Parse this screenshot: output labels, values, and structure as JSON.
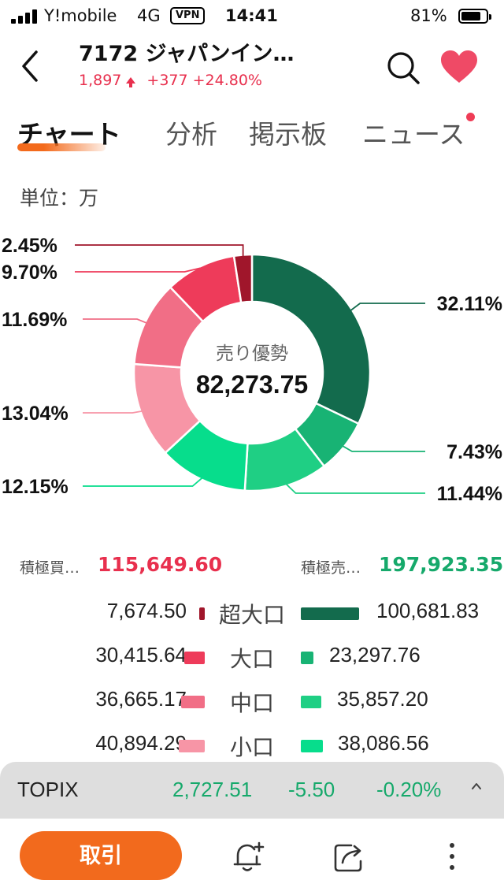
{
  "status_bar": {
    "carrier": "Y!mobile",
    "network": "4G",
    "vpn": "VPN",
    "time": "14:41",
    "battery": "81%"
  },
  "header": {
    "title": "7172 ジャパンイン…",
    "price": "1,897",
    "change": "+377",
    "change_pct": "+24.80%",
    "accent_color": "#e8304e"
  },
  "tabs": [
    {
      "label": "チャート",
      "active": true
    },
    {
      "label": "分析"
    },
    {
      "label": "掲示板"
    },
    {
      "label": "ニュース",
      "badge": true
    }
  ],
  "unit_label": "単位：万",
  "chart_data": {
    "type": "pie",
    "center_label": "売り優勢",
    "center_value": "82,273.75",
    "slices": [
      {
        "label": "32.11%",
        "value": 32.11,
        "color": "#136b4d"
      },
      {
        "label": "7.43%",
        "value": 7.43,
        "color": "#18b374"
      },
      {
        "label": "11.44%",
        "value": 11.44,
        "color": "#1fcf84"
      },
      {
        "label": "12.15%",
        "value": 12.15,
        "color": "#07dd8c"
      },
      {
        "label": "13.04%",
        "value": 13.04,
        "color": "#f795a6"
      },
      {
        "label": "11.69%",
        "value": 11.69,
        "color": "#f16e86"
      },
      {
        "label": "9.70%",
        "value": 9.7,
        "color": "#ee3b5a"
      },
      {
        "label": "2.45%",
        "value": 2.45,
        "color": "#a0162b"
      }
    ]
  },
  "totals": {
    "buy_label": "積極買…",
    "buy_value": "115,649.60",
    "sell_label": "積極売…",
    "sell_value": "197,923.35",
    "buy_color": "#e8304e",
    "sell_color": "#16a96b"
  },
  "breakdown": [
    {
      "name": "超大口",
      "buy": "7,674.50",
      "sell": "100,681.83",
      "buy_color": "#a0162b",
      "sell_color": "#136b4d"
    },
    {
      "name": "大口",
      "buy": "30,415.64",
      "sell": "23,297.76",
      "buy_color": "#ee3b5a",
      "sell_color": "#18b374"
    },
    {
      "name": "中口",
      "buy": "36,665.17",
      "sell": "35,857.20",
      "buy_color": "#f16e86",
      "sell_color": "#1fcf84"
    },
    {
      "name": "小口",
      "buy": "40,894.29",
      "sell": "38,086.56",
      "buy_color": "#f795a6",
      "sell_color": "#07dd8c"
    }
  ],
  "topix": {
    "name": "TOPIX",
    "value": "2,727.51",
    "change": "-5.50",
    "change_pct": "-0.20%"
  },
  "bottom_bar": {
    "trade_label": "取引",
    "icons": [
      "alert-bell-icon",
      "share-icon",
      "more-vertical-icon"
    ]
  }
}
